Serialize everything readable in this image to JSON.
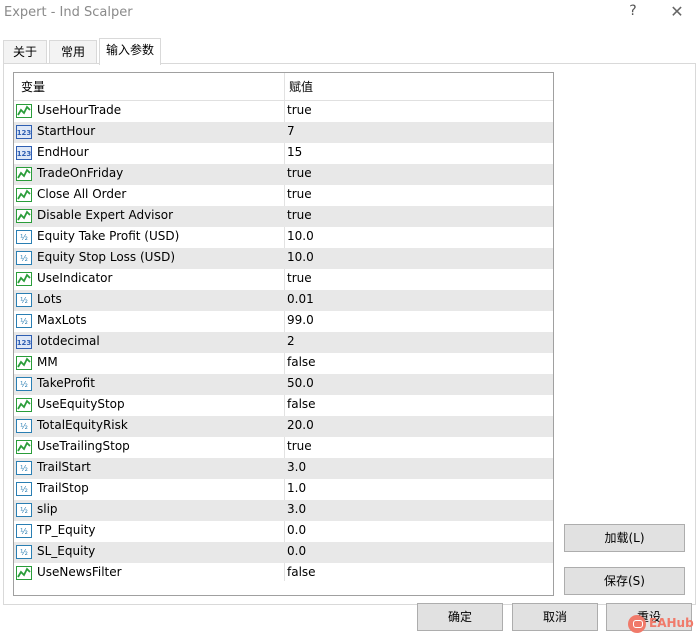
{
  "window": {
    "title": "Expert - Ind Scalper",
    "help": "?",
    "close": "✕"
  },
  "tabs": [
    {
      "label": "关于",
      "active": false
    },
    {
      "label": "常用",
      "active": false
    },
    {
      "label": "输入参数",
      "active": true
    }
  ],
  "grid": {
    "headers": {
      "variable": "变量",
      "value": "赋值"
    },
    "rows": [
      {
        "icon": "bool-icon",
        "name": "UseHourTrade",
        "value": "true"
      },
      {
        "icon": "int-icon",
        "name": "StartHour",
        "value": "7"
      },
      {
        "icon": "int-icon",
        "name": "EndHour",
        "value": "15"
      },
      {
        "icon": "bool-icon",
        "name": "TradeOnFriday",
        "value": "true"
      },
      {
        "icon": "bool-icon",
        "name": "Close All Order",
        "value": "true"
      },
      {
        "icon": "bool-icon",
        "name": "Disable Expert Advisor",
        "value": "true"
      },
      {
        "icon": "double-icon",
        "name": "Equity Take Profit (USD)",
        "value": "10.0"
      },
      {
        "icon": "double-icon",
        "name": "Equity Stop Loss (USD)",
        "value": "10.0"
      },
      {
        "icon": "bool-icon",
        "name": "UseIndicator",
        "value": "true"
      },
      {
        "icon": "double-icon",
        "name": "Lots",
        "value": "0.01"
      },
      {
        "icon": "double-icon",
        "name": "MaxLots",
        "value": "99.0"
      },
      {
        "icon": "int-icon",
        "name": "lotdecimal",
        "value": "2"
      },
      {
        "icon": "bool-icon",
        "name": "MM",
        "value": "false"
      },
      {
        "icon": "double-icon",
        "name": "TakeProfit",
        "value": "50.0"
      },
      {
        "icon": "bool-icon",
        "name": "UseEquityStop",
        "value": "false"
      },
      {
        "icon": "double-icon",
        "name": "TotalEquityRisk",
        "value": "20.0"
      },
      {
        "icon": "bool-icon",
        "name": "UseTrailingStop",
        "value": "true"
      },
      {
        "icon": "double-icon",
        "name": "TrailStart",
        "value": "3.0"
      },
      {
        "icon": "double-icon",
        "name": "TrailStop",
        "value": "1.0"
      },
      {
        "icon": "double-icon",
        "name": "slip",
        "value": "3.0"
      },
      {
        "icon": "double-icon",
        "name": "TP_Equity",
        "value": "0.0"
      },
      {
        "icon": "double-icon",
        "name": "SL_Equity",
        "value": "0.0"
      },
      {
        "icon": "bool-icon",
        "name": "UseNewsFilter",
        "value": "false"
      }
    ]
  },
  "side_buttons": {
    "load": "加载(L)",
    "save": "保存(S)"
  },
  "footer_buttons": {
    "ok": "确定",
    "cancel": "取消",
    "reset": "重设"
  },
  "watermark": {
    "text": "EAHub"
  },
  "colors": {
    "bool_icon": "#2a9d3a",
    "int_icon": "#2f5fb3",
    "double_icon": "#2a7fb3",
    "alt_row": "#e8e8e8"
  }
}
